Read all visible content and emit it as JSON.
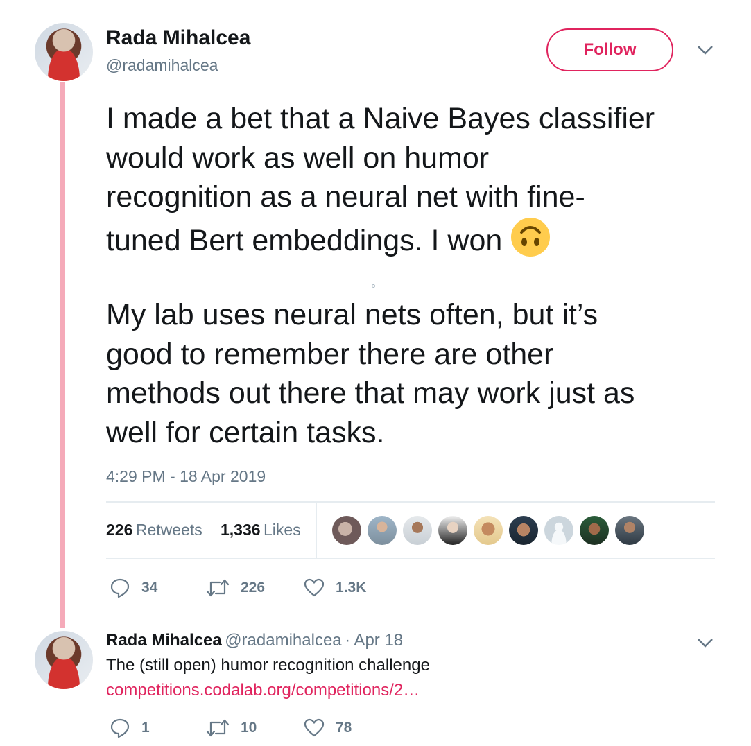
{
  "tweet": {
    "author_name": "Rada Mihalcea",
    "author_handle": "@radamihalcea",
    "follow_label": "Follow",
    "text_part1": "I made a bet that a Naive Bayes classifier\nwould work as well on humor\nrecognition as a neural net with fine-\ntuned Bert embeddings. I won ",
    "emoji": "upside-down-face-emoji",
    "text_part2": "My lab uses neural nets often, but it’s\ngood to remember there are other\nmethods out there that may work just as\nwell for certain tasks.",
    "timestamp": "4:29 PM - 18 Apr 2019",
    "retweets_count": "226",
    "retweets_label": "Retweets",
    "likes_count": "1,336",
    "likes_label": "Likes",
    "liker_avatars": [
      "liker-avatar-1",
      "liker-avatar-2",
      "liker-avatar-3",
      "liker-avatar-4",
      "liker-avatar-5",
      "liker-avatar-6",
      "liker-avatar-7",
      "liker-avatar-8",
      "liker-avatar-9"
    ],
    "actions": {
      "replies": "34",
      "retweets": "226",
      "likes": "1.3K"
    }
  },
  "reply": {
    "author_name": "Rada Mihalcea",
    "author_handle": "@radamihalcea",
    "date": "· Apr 18",
    "text": "The (still open) humor recognition challenge",
    "link": "competitions.codalab.org/competitions/2…",
    "actions": {
      "replies": "1",
      "retweets": "10",
      "likes": "78"
    }
  },
  "colors": {
    "accent": "#e0245e",
    "thread_line": "#f5aab9",
    "muted": "#657786"
  }
}
